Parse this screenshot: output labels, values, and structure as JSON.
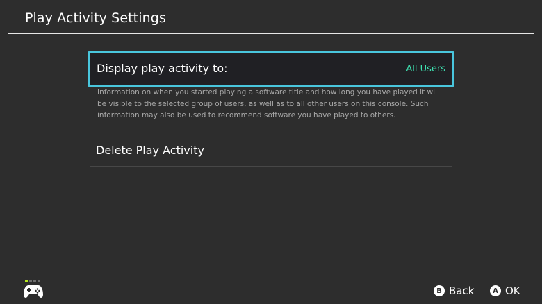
{
  "header": {
    "title": "Play Activity Settings"
  },
  "settings": {
    "display_activity": {
      "label": "Display play activity to:",
      "value": "All Users",
      "description": "Information on when you started playing a software title and how long you have played it will be visible to the selected group of users, as well as to all other users on this console. Such information may also be used to recommend software you have played to others."
    },
    "delete_activity": {
      "label": "Delete Play Activity"
    }
  },
  "footer": {
    "controller_icon": "controller-icon",
    "back": {
      "glyph": "B",
      "label": "Back"
    },
    "ok": {
      "glyph": "A",
      "label": "OK"
    }
  },
  "colors": {
    "background": "#2d2d2d",
    "selection_border": "#49c6dd",
    "value_text": "#3ee0b0",
    "player_indicator": "#b5e61d"
  }
}
